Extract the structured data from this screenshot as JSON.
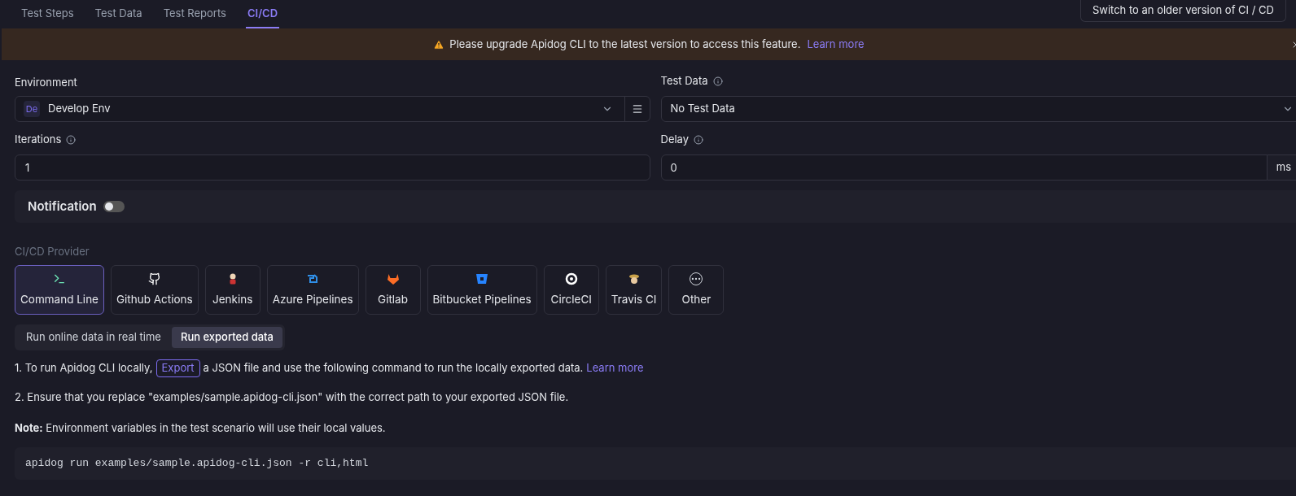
{
  "tabs": [
    {
      "label": "Test Steps",
      "selected": false
    },
    {
      "label": "Test Data",
      "selected": false
    },
    {
      "label": "Test Reports",
      "selected": false
    },
    {
      "label": "CI/CD",
      "selected": true
    }
  ],
  "switch_button": "Switch to an older version of CI / CD",
  "banner": {
    "message": "Please upgrade Apidog CLI to the latest version to access this feature.",
    "link": "Learn more"
  },
  "environment": {
    "label": "Environment",
    "badge": "De",
    "value": "Develop Env"
  },
  "test_data": {
    "label": "Test Data",
    "value": "No Test Data"
  },
  "iterations": {
    "label": "Iterations",
    "value": "1"
  },
  "delay": {
    "label": "Delay",
    "value": "0",
    "unit": "ms"
  },
  "notification": {
    "label": "Notification",
    "on": false
  },
  "provider": {
    "label": "CI/CD Provider",
    "items": [
      {
        "label": "Command Line",
        "kind": "terminal",
        "selected": true
      },
      {
        "label": "Github Actions",
        "kind": "github",
        "selected": false
      },
      {
        "label": "Jenkins",
        "kind": "jenkins",
        "selected": false
      },
      {
        "label": "Azure Pipelines",
        "kind": "azure",
        "selected": false
      },
      {
        "label": "Gitlab",
        "kind": "gitlab",
        "selected": false
      },
      {
        "label": "Bitbucket Pipelines",
        "kind": "bitbucket",
        "selected": false
      },
      {
        "label": "CircleCI",
        "kind": "circleci",
        "selected": false
      },
      {
        "label": "Travis CI",
        "kind": "travis",
        "selected": false
      },
      {
        "label": "Other",
        "kind": "other",
        "selected": false
      }
    ]
  },
  "modes": [
    {
      "label": "Run online data in real time",
      "selected": false
    },
    {
      "label": "Run exported data",
      "selected": true
    }
  ],
  "step_1": {
    "before": "1. To run Apidog CLI locally,",
    "button": "Export",
    "after": "a JSON file and use the following command to run the locally exported data.",
    "link": "Learn more"
  },
  "step_2": "2. Ensure that you replace \"examples/sample.apidog-cli.json\" with the correct path to your exported JSON file.",
  "note": "**Note:** Environment variables in the test scenario will use their local values.",
  "command": "apidog run examples/sample.apidog-cli.json -r cli,html"
}
